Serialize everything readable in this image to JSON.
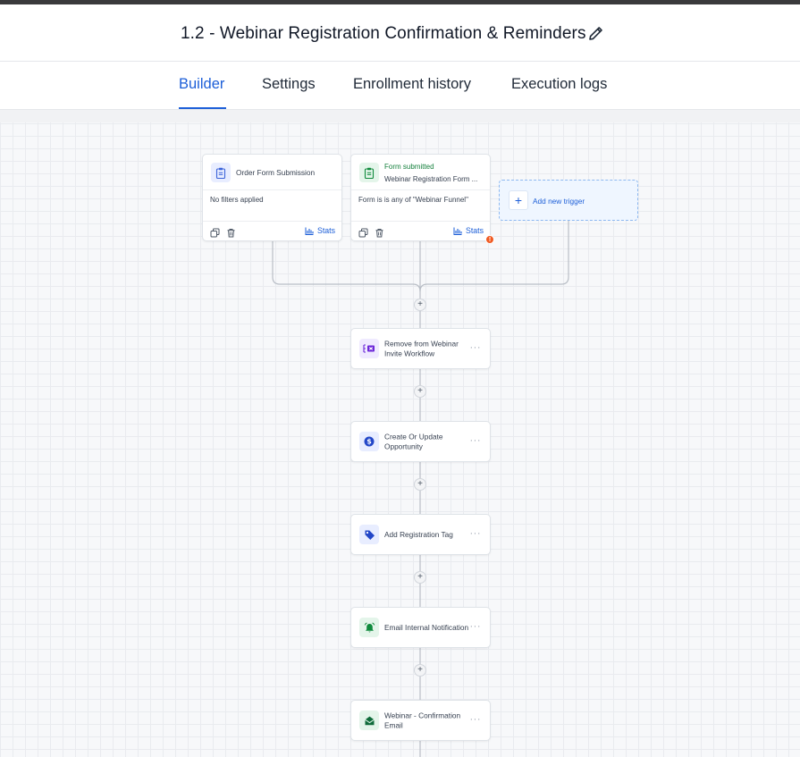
{
  "workflow": {
    "title": "1.2 - Webinar Registration Confirmation & Reminders"
  },
  "tabs": [
    {
      "label": "Builder",
      "active": true
    },
    {
      "label": "Settings",
      "active": false
    },
    {
      "label": "Enrollment history",
      "active": false
    },
    {
      "label": "Execution logs",
      "active": false
    }
  ],
  "triggers": [
    {
      "title": "Order Form Submission",
      "filter": "No filters applied",
      "stats_label": "Stats",
      "icon": "clipboard-icon"
    },
    {
      "status": "Form submitted",
      "title": "Webinar Registration Form ...",
      "filter": "Form is is any of \"Webinar Funnel\"",
      "stats_label": "Stats",
      "icon": "clipboard-icon",
      "warning": "!"
    }
  ],
  "add_trigger": {
    "icon": "+",
    "label": "Add new trigger"
  },
  "plus_symbol": "+",
  "more_symbol": "···",
  "actions": [
    {
      "label": "Remove from Webinar Invite Workflow",
      "icon": "workflow-remove-icon"
    },
    {
      "label": "Create Or Update Opportunity",
      "icon": "dollar-icon"
    },
    {
      "label": "Add Registration Tag",
      "icon": "tag-icon"
    },
    {
      "label": "Email Internal Notification",
      "icon": "alarm-bell-icon"
    },
    {
      "label": "Webinar - Confirmation Email",
      "icon": "email-open-icon"
    }
  ],
  "colors": {
    "accent": "#1d5fd8",
    "success": "#15803d",
    "warning": "#f05a22",
    "purple": "#6d28d9",
    "green_icon": "#0f8a3c"
  }
}
